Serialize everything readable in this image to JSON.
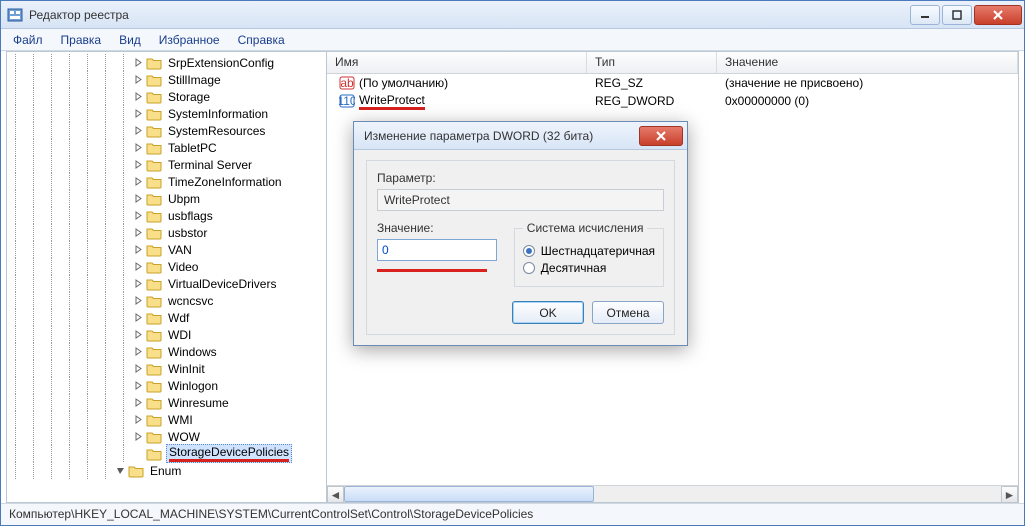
{
  "window": {
    "title": "Редактор реестра"
  },
  "menu": {
    "file": "Файл",
    "edit": "Правка",
    "view": "Вид",
    "favorites": "Избранное",
    "help": "Справка"
  },
  "tree": {
    "items": [
      "SrpExtensionConfig",
      "StillImage",
      "Storage",
      "SystemInformation",
      "SystemResources",
      "TabletPC",
      "Terminal Server",
      "TimeZoneInformation",
      "Ubpm",
      "usbflags",
      "usbstor",
      "VAN",
      "Video",
      "VirtualDeviceDrivers",
      "wcncsvc",
      "Wdf",
      "WDI",
      "Windows",
      "WinInit",
      "Winlogon",
      "Winresume",
      "WMI",
      "WOW"
    ],
    "selected": "StorageDevicePolicies",
    "next": "Enum"
  },
  "columns": {
    "name": "Имя",
    "type": "Тип",
    "value": "Значение"
  },
  "rows": [
    {
      "name": "(По умолчанию)",
      "type": "REG_SZ",
      "value": "(значение не присвоено)",
      "icon": "str"
    },
    {
      "name": "WriteProtect",
      "type": "REG_DWORD",
      "value": "0x00000000 (0)",
      "icon": "bin"
    }
  ],
  "status": "Компьютер\\HKEY_LOCAL_MACHINE\\SYSTEM\\CurrentControlSet\\Control\\StorageDevicePolicies",
  "dialog": {
    "title": "Изменение параметра DWORD (32 бита)",
    "param_label": "Параметр:",
    "param_value": "WriteProtect",
    "value_label": "Значение:",
    "value_input": "0",
    "base_label": "Система исчисления",
    "hex": "Шестнадцатеричная",
    "dec": "Десятичная",
    "ok": "OK",
    "cancel": "Отмена"
  }
}
